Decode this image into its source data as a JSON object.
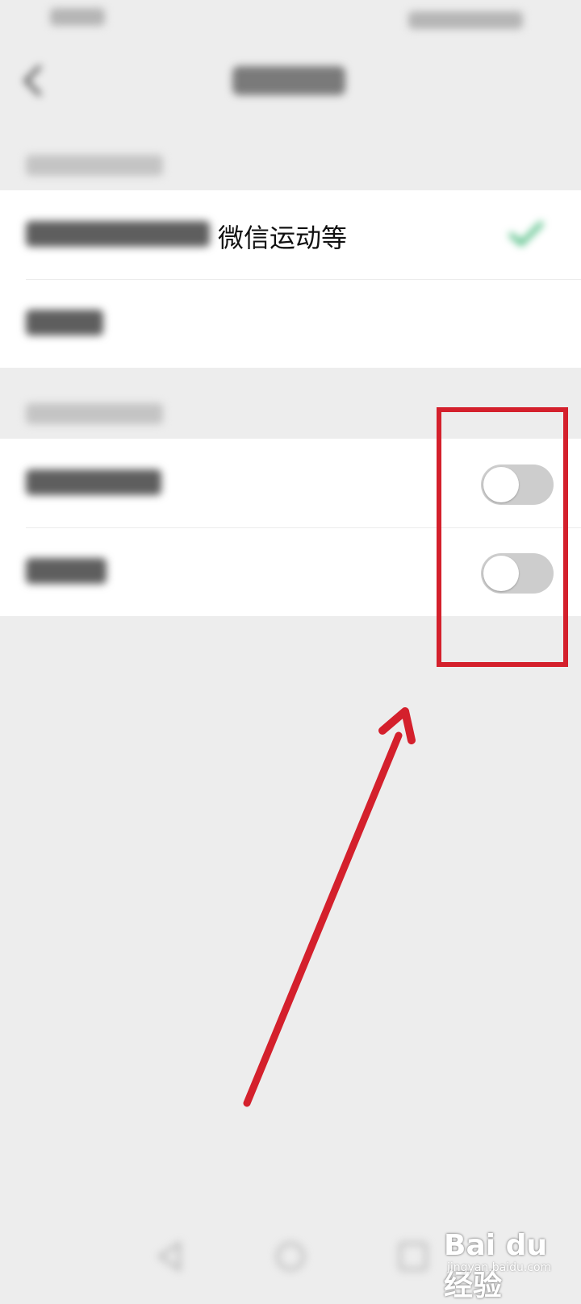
{
  "colors": {
    "background": "#ededed",
    "card": "#ffffff",
    "check": "#2aae67",
    "toggle_off": "#cdcdcd",
    "annotation": "#d4202c"
  },
  "nav": {
    "back_icon": "chevron-left-icon"
  },
  "group1": {
    "rows": [
      {
        "label": "微信运动等",
        "selected": true,
        "icon": "check-icon"
      },
      {
        "label": ""
      }
    ]
  },
  "group2": {
    "rows": [
      {
        "label": "",
        "toggle": "off"
      },
      {
        "label": "",
        "toggle": "off"
      }
    ]
  },
  "system_nav": {
    "icons": [
      "back-triangle-icon",
      "home-circle-icon",
      "recent-square-icon"
    ]
  },
  "watermark": {
    "brand": "Bai du 经验",
    "sub": "jingyan.baidu.com"
  }
}
